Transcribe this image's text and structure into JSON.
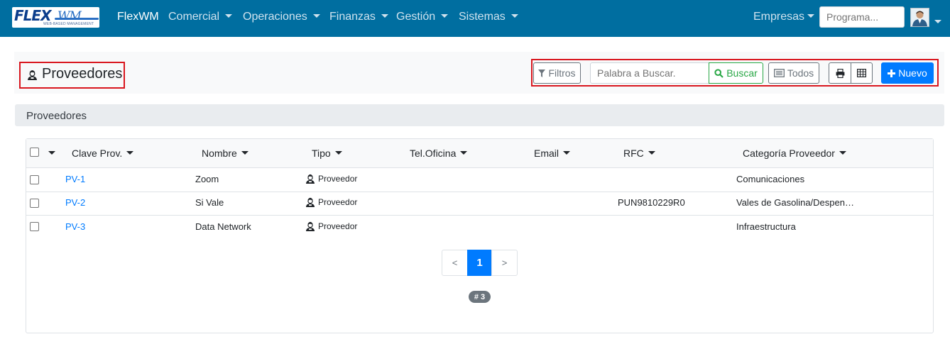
{
  "navbar": {
    "logo_text": "FLEX",
    "logo_text2": "WM",
    "logo_sub": "WEB-BASED MANAGEMENT",
    "brand": "FlexWM",
    "menus": [
      "Comercial",
      "Operaciones",
      "Finanzas",
      "Gestión",
      "Sistemas"
    ],
    "empresas": "Empresas",
    "programa_placeholder": "Programa..."
  },
  "page": {
    "title": "Proveedores",
    "section_title": "Proveedores"
  },
  "toolbar": {
    "filtros": "Filtros",
    "search_placeholder": "Palabra a Buscar.",
    "buscar": "Buscar",
    "todos": "Todos",
    "nuevo": "Nuevo"
  },
  "table": {
    "columns": [
      "Clave Prov.",
      "Nombre",
      "Tipo",
      "Tel.Oficina",
      "Email",
      "RFC",
      "Categoría Proveedor"
    ],
    "rows": [
      {
        "clave": "PV-1",
        "nombre": "Zoom",
        "tipo": "Proveedor",
        "tel": "",
        "email": "",
        "rfc": "",
        "categoria": "Comunicaciones"
      },
      {
        "clave": "PV-2",
        "nombre": "Si Vale",
        "tipo": "Proveedor",
        "tel": "",
        "email": "",
        "rfc": "PUN9810229R0",
        "categoria": "Vales de Gasolina/Despen…"
      },
      {
        "clave": "PV-3",
        "nombre": "Data Network",
        "tipo": "Proveedor",
        "tel": "",
        "email": "",
        "rfc": "",
        "categoria": "Infraestructura"
      }
    ]
  },
  "pagination": {
    "prev": "<",
    "current": "1",
    "next": ">",
    "count": "# 3"
  },
  "colors": {
    "navbar": "#006ea0",
    "primary": "#007bff",
    "success": "#28a745",
    "highlight": "#d9161e"
  }
}
